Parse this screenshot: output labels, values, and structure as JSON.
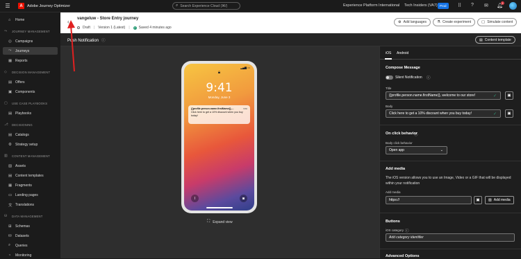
{
  "topbar": {
    "app_name": "Adobe Journey Optimizer",
    "search_placeholder": "Search Experience Cloud (⌘/)",
    "org": "Experience Platform International",
    "sandbox": "Tech Insiders (VA7)",
    "env_badge": "Prod",
    "notification_count": "1"
  },
  "sidebar": {
    "home": "Home",
    "sections": [
      {
        "title": "JOURNEY MANAGEMENT",
        "items": [
          "Campaigns",
          "Journeys",
          "Reports"
        ]
      },
      {
        "title": "DECISION MANAGEMENT",
        "items": [
          "Offers",
          "Components"
        ]
      },
      {
        "title": "USE CASE PLAYBOOKS",
        "items": [
          "Playbooks"
        ]
      },
      {
        "title": "DECISIONING",
        "items": [
          "Catalogs",
          "Strategy setup"
        ]
      },
      {
        "title": "CONTENT MANAGEMENT",
        "items": [
          "Assets",
          "Content templates",
          "Fragments",
          "Landing pages",
          "Translations"
        ]
      },
      {
        "title": "DATA MANAGEMENT",
        "items": [
          "Schemas",
          "Datasets",
          "Queries",
          "Monitoring"
        ]
      }
    ],
    "active_item": "Journeys"
  },
  "header": {
    "journey_title": "vangeluw - Store Entry journey",
    "status": "Draft",
    "version": "Version 1 (Latest)",
    "saved": "Saved 4 minutes ago",
    "add_languages": "Add languages",
    "create_experiment": "Create experiment",
    "simulate_content": "Simulate content"
  },
  "subbar": {
    "title": "Push Notification",
    "content_template": "Content template"
  },
  "preview": {
    "time": "9:41",
    "date": "Monday, June 3",
    "notif_title": "{{profile.person.name.firstName}},...",
    "notif_now": "now",
    "notif_body": "Click here to get a 10% discount when you buy today!",
    "expand_view": "Expand view"
  },
  "panel": {
    "tabs": [
      "iOS",
      "Android"
    ],
    "selected_tab": "iOS",
    "compose_title": "Compose Message",
    "silent_notification": "Silent Notification",
    "title_label": "Title",
    "title_value": "{{profile.person.name.firstName}}, welcome to our store!",
    "body_label": "Body",
    "body_value": "Click here to get a 10% discount when you buy today!",
    "on_click_title": "On click behavior",
    "body_click_label": "Body click behavior",
    "body_click_value": "Open app",
    "add_media_title": "Add media",
    "add_media_desc": "The iOS version allows you to use an Image, Video or a GIF that will be displayed within your notification",
    "add_media_label": "Add media",
    "media_value": "https://",
    "add_media_button": "Add media",
    "buttons_title": "Buttons",
    "ios_category_label": "iOS category",
    "category_placeholder": "Add category identifier",
    "advanced_options": "Advanced Options"
  },
  "colors": {
    "accent": "#1473e6",
    "success": "#2d9d78",
    "adobe_red": "#eb1000"
  }
}
